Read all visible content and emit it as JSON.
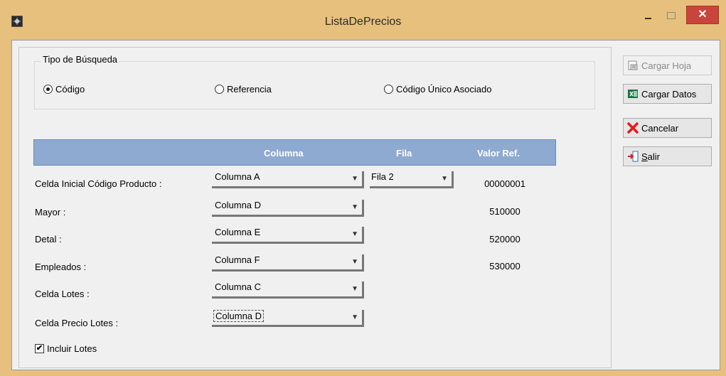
{
  "window": {
    "title": "ListaDePrecios",
    "close_glyph": "✕"
  },
  "search_type": {
    "legend": "Tipo de Búsqueda",
    "options": [
      {
        "label": "Código",
        "selected": true
      },
      {
        "label": "Referencia",
        "selected": false
      },
      {
        "label": "Código Único Asociado",
        "selected": false
      }
    ]
  },
  "table": {
    "headers": {
      "columna": "Columna",
      "fila": "Fila",
      "valor_ref": "Valor Ref."
    },
    "rows": [
      {
        "label": "Celda Inicial Código Producto :",
        "columna": "Columna A",
        "fila": "Fila 2",
        "valor_ref": "00000001"
      },
      {
        "label": "Mayor :",
        "columna": "Columna D",
        "valor_ref": "510000"
      },
      {
        "label": "Detal :",
        "columna": "Columna E",
        "valor_ref": "520000"
      },
      {
        "label": "Empleados :",
        "columna": "Columna F",
        "valor_ref": "530000"
      },
      {
        "label": "Celda Lotes :",
        "columna": "Columna C"
      },
      {
        "label": "Celda Precio Lotes :",
        "columna": "Columna D"
      }
    ]
  },
  "include_lots": {
    "label": "Incluir Lotes",
    "checked": true,
    "check_glyph": "✔"
  },
  "actions": {
    "cargar_hoja": {
      "label": "Cargar Hoja",
      "icon": "sheet-icon",
      "enabled": false
    },
    "cargar_datos": {
      "label": "Cargar Datos",
      "icon": "excel-icon",
      "enabled": true
    },
    "cancelar": {
      "label": "Cancelar",
      "icon": "red-x-icon",
      "enabled": true
    },
    "salir_prefix": "S",
    "salir_rest": "alir",
    "salir_icon": "exit-door-icon"
  },
  "colors": {
    "title_bar": "#e8c07d",
    "header_band": "#8eaad0",
    "close_button": "#c9453b",
    "cancel_icon": "#e01b1b"
  }
}
